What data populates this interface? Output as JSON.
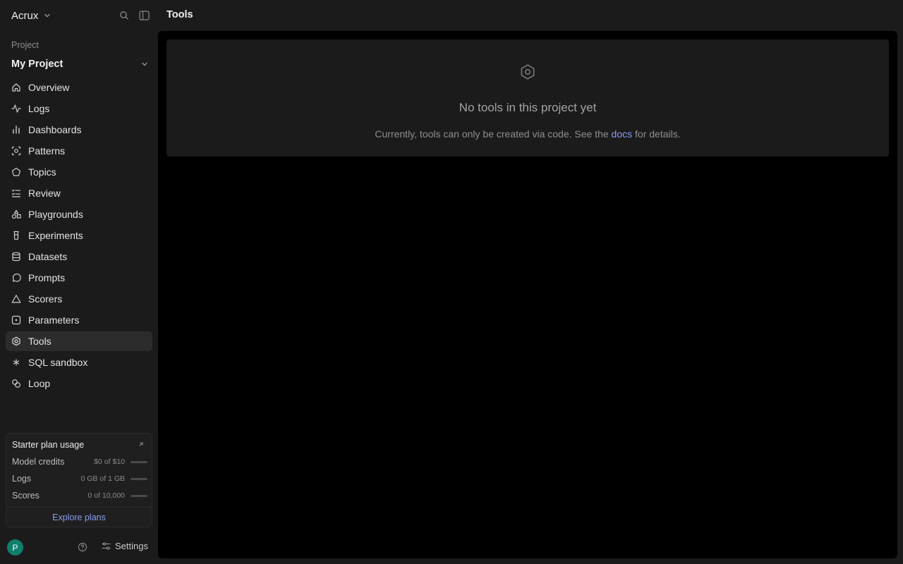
{
  "org": {
    "name": "Acrux"
  },
  "project": {
    "label": "Project",
    "name": "My Project"
  },
  "nav": [
    {
      "label": "Overview",
      "icon": "home-icon"
    },
    {
      "label": "Logs",
      "icon": "activity-icon"
    },
    {
      "label": "Dashboards",
      "icon": "bar-chart-icon"
    },
    {
      "label": "Patterns",
      "icon": "scan-face-icon"
    },
    {
      "label": "Topics",
      "icon": "pentagon-icon"
    },
    {
      "label": "Review",
      "icon": "list-checks-icon"
    },
    {
      "label": "Playgrounds",
      "icon": "shapes-icon"
    },
    {
      "label": "Experiments",
      "icon": "beaker-icon"
    },
    {
      "label": "Datasets",
      "icon": "database-icon"
    },
    {
      "label": "Prompts",
      "icon": "message-circle-icon"
    },
    {
      "label": "Scorers",
      "icon": "triangle-icon"
    },
    {
      "label": "Parameters",
      "icon": "square-dot-icon"
    },
    {
      "label": "Tools",
      "icon": "hexagon-icon",
      "active": true
    },
    {
      "label": "SQL sandbox",
      "icon": "asterisk-icon"
    },
    {
      "label": "Loop",
      "icon": "loop-icon"
    }
  ],
  "usage": {
    "title": "Starter plan usage",
    "rows": [
      {
        "label": "Model credits",
        "value": "$0 of $10",
        "fraction": 0
      },
      {
        "label": "Logs",
        "value": "0 GB of 1 GB",
        "fraction": 0
      },
      {
        "label": "Scores",
        "value": "0 of 10,000",
        "fraction": 0
      }
    ],
    "explore_label": "Explore plans"
  },
  "footer": {
    "avatar_initial": "P",
    "settings_label": "Settings"
  },
  "main": {
    "title": "Tools",
    "empty_title": "No tools in this project yet",
    "empty_desc_before": "Currently, tools can only be created via code. See the",
    "empty_desc_link": "docs",
    "empty_desc_after": "for details."
  },
  "colors": {
    "accent_link": "#8a9cf0",
    "avatar_bg": "#0f7f6d",
    "active_item_bg": "#2c2c2c"
  }
}
